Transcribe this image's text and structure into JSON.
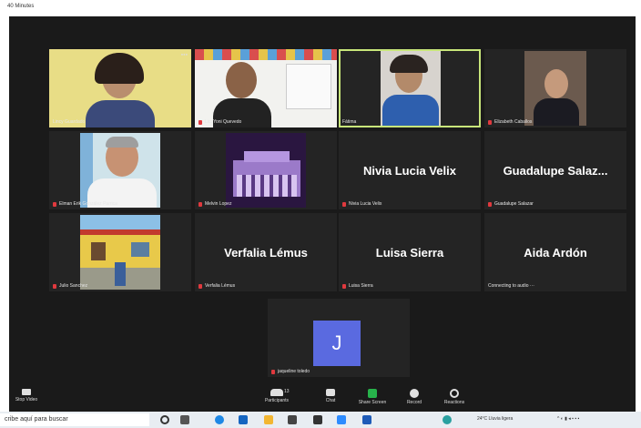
{
  "window": {
    "title": "40 Minutes"
  },
  "tiles": [
    {
      "name": "Lincy Guardado",
      "caption": "Lincy Guardado",
      "muted": false,
      "type": "photo"
    },
    {
      "name": "Lic. Yoni Quevedo",
      "caption": "Lic. Yoni Quevedo",
      "muted": true,
      "type": "photo"
    },
    {
      "name": "Fátima",
      "caption": "Fátima",
      "muted": false,
      "type": "photo",
      "active": true
    },
    {
      "name": "Elizabeth Caballos",
      "caption": "Elizabeth Caballos",
      "muted": true,
      "type": "photo"
    },
    {
      "name": "Elman Erik González Parrica",
      "caption": "Elman Erik González Parrica",
      "muted": true,
      "type": "photo"
    },
    {
      "name": "Melvin Lopez",
      "caption": "Melvin Lopez",
      "muted": true,
      "type": "photo"
    },
    {
      "name": "Nivia Lucia Velix",
      "caption": "Nivia Lucia Velix",
      "muted": true,
      "type": "name"
    },
    {
      "name": "Guadalupe  Salaz...",
      "caption": "Guadalupe Salazar",
      "muted": true,
      "type": "name"
    },
    {
      "name": "Julio Sanchez",
      "caption": "Julio Sanchez",
      "muted": true,
      "type": "photo"
    },
    {
      "name": "Verfalia Lémus",
      "caption": "Verfalia Lémus",
      "muted": true,
      "type": "name"
    },
    {
      "name": "Luisa Sierra",
      "caption": "Luisa Sierra",
      "muted": true,
      "type": "name"
    },
    {
      "name": "Aida Ardón",
      "caption": "Connecting to audio ···",
      "muted": false,
      "type": "name"
    },
    {
      "name": "J",
      "caption": "jaqueline toledo",
      "muted": true,
      "type": "avatar"
    }
  ],
  "toolbar": {
    "stop_video": "Stop Video",
    "participants": "Participants",
    "participants_count": "13",
    "chat": "Chat",
    "share_screen": "Share Screen",
    "record": "Record",
    "reactions": "Reactions"
  },
  "taskbar": {
    "search_placeholder": "cribe aquí para buscar",
    "weather": "24°C  Lluvia ligera"
  },
  "colors": {
    "active_border": "#c8e67a",
    "avatar_bg": "#5a6ae0",
    "share_green": "#27b34b",
    "muted_red": "#e0393e"
  }
}
